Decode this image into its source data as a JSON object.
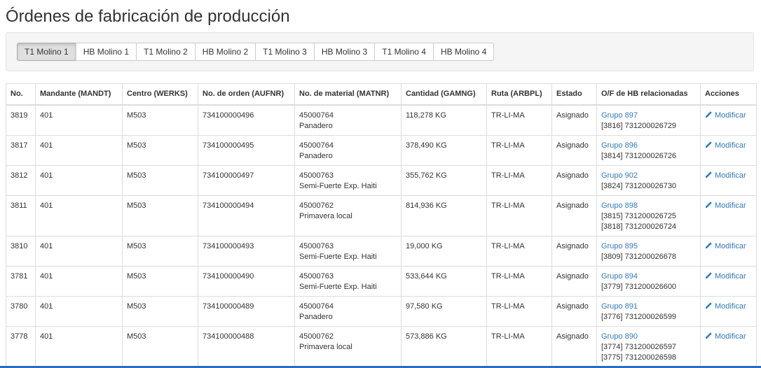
{
  "page": {
    "title": "Órdenes de fabricación de producción"
  },
  "tabs": [
    {
      "label": "T1 Molino 1",
      "active": true
    },
    {
      "label": "HB Molino 1",
      "active": false
    },
    {
      "label": "T1 Molino 2",
      "active": false
    },
    {
      "label": "HB Molino 2",
      "active": false
    },
    {
      "label": "T1 Molino 3",
      "active": false
    },
    {
      "label": "HB Molino 3",
      "active": false
    },
    {
      "label": "T1 Molino 4",
      "active": false
    },
    {
      "label": "HB Molino 4",
      "active": false
    }
  ],
  "table": {
    "headers": [
      "No.",
      "Mandante (MANDT)",
      "Centro (WERKS)",
      "No. de orden (AUFNR)",
      "No. de material (MATNR)",
      "Cantidad (GAMNG)",
      "Ruta (ARBPL)",
      "Estado",
      "O/F de HB relacionadas",
      "Acciones"
    ],
    "action_label": "Modificar",
    "rows": [
      {
        "no": "3819",
        "mandt": "401",
        "werks": "M503",
        "aufnr": "734100000496",
        "matnr": "45000764",
        "material": "Panadero",
        "gamng": "118,278 KG",
        "arbpl": "TR-LI-MA",
        "estado": "Asignado",
        "grupo": "Grupo 897",
        "related": [
          "[3816] 731200026729"
        ]
      },
      {
        "no": "3817",
        "mandt": "401",
        "werks": "M503",
        "aufnr": "734100000495",
        "matnr": "45000764",
        "material": "Panadero",
        "gamng": "378,490 KG",
        "arbpl": "TR-LI-MA",
        "estado": "Asignado",
        "grupo": "Grupo 896",
        "related": [
          "[3814] 731200026726"
        ]
      },
      {
        "no": "3812",
        "mandt": "401",
        "werks": "M503",
        "aufnr": "734100000497",
        "matnr": "45000763",
        "material": "Semi-Fuerte Exp. Haiti",
        "gamng": "355,762 KG",
        "arbpl": "TR-LI-MA",
        "estado": "Asignado",
        "grupo": "Grupo 902",
        "related": [
          "[3824] 731200026730"
        ]
      },
      {
        "no": "3811",
        "mandt": "401",
        "werks": "M503",
        "aufnr": "734100000494",
        "matnr": "45000762",
        "material": "Primavera local",
        "gamng": "814,936 KG",
        "arbpl": "TR-LI-MA",
        "estado": "Asignado",
        "grupo": "Grupo 898",
        "related": [
          "[3815] 731200026725",
          "[3818] 731200026724"
        ]
      },
      {
        "no": "3810",
        "mandt": "401",
        "werks": "M503",
        "aufnr": "734100000493",
        "matnr": "45000763",
        "material": "Semi-Fuerte Exp. Haiti",
        "gamng": "19,000 KG",
        "arbpl": "TR-LI-MA",
        "estado": "Asignado",
        "grupo": "Grupo 895",
        "related": [
          "[3809] 731200026678"
        ]
      },
      {
        "no": "3781",
        "mandt": "401",
        "werks": "M503",
        "aufnr": "734100000490",
        "matnr": "45000763",
        "material": "Semi-Fuerte Exp. Haiti",
        "gamng": "533,644 KG",
        "arbpl": "TR-LI-MA",
        "estado": "Asignado",
        "grupo": "Grupo 894",
        "related": [
          "[3779] 731200026600"
        ]
      },
      {
        "no": "3780",
        "mandt": "401",
        "werks": "M503",
        "aufnr": "734100000489",
        "matnr": "45000764",
        "material": "Panadero",
        "gamng": "97,580 KG",
        "arbpl": "TR-LI-MA",
        "estado": "Asignado",
        "grupo": "Grupo 891",
        "related": [
          "[3776] 731200026599"
        ]
      },
      {
        "no": "3778",
        "mandt": "401",
        "werks": "M503",
        "aufnr": "734100000488",
        "matnr": "45000762",
        "material": "Primavera local",
        "gamng": "573,886 KG",
        "arbpl": "TR-LI-MA",
        "estado": "Asignado",
        "grupo": "Grupo 890",
        "related": [
          "[3774] 731200026597",
          "[3775] 731200026598"
        ]
      }
    ]
  },
  "colors": {
    "link": "#337ab7",
    "border": "#dddddd",
    "well": "#f5f5f5",
    "bottom_bar": "#2a6ebb"
  }
}
